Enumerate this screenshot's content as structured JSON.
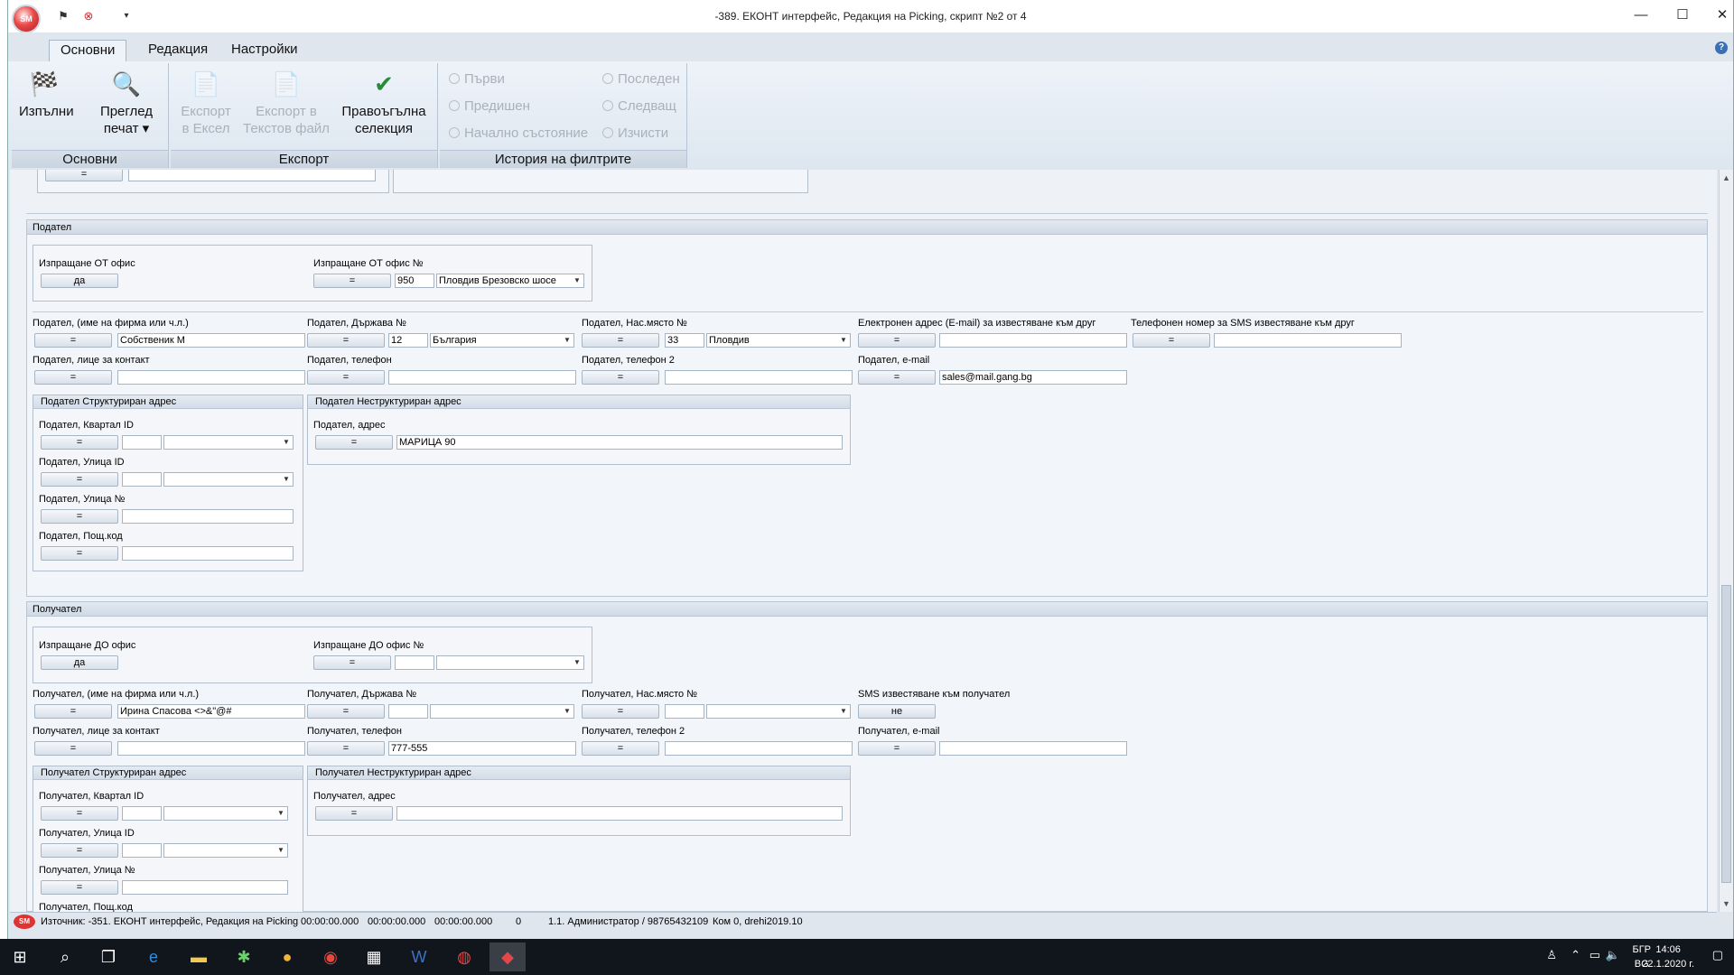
{
  "window": {
    "title": "-389. ЕКОНТ интерфейс, Редакция на Picking, скрипт №2 от 4",
    "app_badge": "SM",
    "minimize": "—",
    "maximize": "☐",
    "close": "✕"
  },
  "ribbon": {
    "tabs": [
      "Основни",
      "Редакция",
      "Настройки"
    ],
    "groups": {
      "main": {
        "caption": "Основни",
        "run_label": "Изпълни",
        "preview_label_1": "Преглед",
        "preview_label_2": "печат ▾"
      },
      "export": {
        "caption": "Експорт",
        "excel_1": "Експорт",
        "excel_2": "в Ексел",
        "text_1": "Експорт в",
        "text_2": "Текстов файл",
        "rect_1": "Правоъгълна",
        "rect_2": "селекция"
      },
      "history": {
        "caption": "История на филтрите",
        "first": "Първи",
        "last": "Последен",
        "prev": "Предишен",
        "next": "Следващ",
        "initial": "Начално състояние",
        "clear": "Изчисти"
      }
    }
  },
  "sender": {
    "section_title": "Подател",
    "office_flag_label": "Изпращане ОТ офис",
    "office_flag_value": "да",
    "office_no_label": "Изпращане ОТ офис №",
    "office_no": "950",
    "office_name": "Пловдив Брезовско шосе",
    "name_label": "Подател, (име на фирма или ч.л.)",
    "name_value": "Собственик М",
    "country_label": "Подател, Държава №",
    "country_no": "12",
    "country_name": "България",
    "city_label": "Подател, Нас.място №",
    "city_no": "33",
    "city_name": "Пловдив",
    "email_notify_label": "Електронен адрес (E-mail) за известяване към друг",
    "sms_notify_label": "Телефонен номер за SMS известяване към друг",
    "contact_label": "Подател, лице за контакт",
    "phone_label": "Подател, телефон",
    "phone2_label": "Подател, телефон 2",
    "email_label": "Подател, e-mail",
    "email_value": "sales@mail.gang.bg",
    "struct_title": "Подател Структуриран адрес",
    "quarter_label": "Подател, Квартал ID",
    "street_label": "Подател, Улица ID",
    "street_no_label": "Подател, Улица №",
    "postcode_label": "Подател, Пощ.код",
    "unstruct_title": "Подател Неструктуриран адрес",
    "address_label": "Подател, адрес",
    "address_value": "МАРИЦА 90"
  },
  "receiver": {
    "section_title": "Получател",
    "office_flag_label": "Изпращане ДО офис",
    "office_flag_value": "да",
    "office_no_label": "Изпращане ДО офис №",
    "name_label": "Получател, (име на фирма или ч.л.)",
    "name_value": "Ирина Спасова <>&\"@#",
    "country_label": "Получател, Държава №",
    "city_label": "Получател, Нас.място №",
    "sms_label": "SMS известяване към получател",
    "sms_value": "не",
    "contact_label": "Получател, лице за контакт",
    "phone_label": "Получател, телефон",
    "phone_value": "777-555",
    "phone2_label": "Получател, телефон 2",
    "email_label": "Получател, e-mail",
    "struct_title": "Получател Структуриран адрес",
    "quarter_label": "Получател, Квартал ID",
    "street_label": "Получател, Улица ID",
    "street_no_label": "Получател, Улица №",
    "postcode_label": "Получател, Пощ.код",
    "unstruct_title": "Получател Неструктуриран адрес",
    "address_label": "Получател, адрес"
  },
  "common": {
    "eq": "="
  },
  "statusbar": {
    "source": "Източник: -351. ЕКОНТ интерфейс, Редакция на Picking",
    "t1": "00:00:00.000",
    "t2": "00:00:00.000",
    "t3": "00:00:00.000",
    "count": "0",
    "user": "1.1. Администратор / 98765432109",
    "info": "Ком 0, drehi2019.10"
  },
  "taskbar": {
    "lang_top": "БГР",
    "lang_bottom": "BG",
    "time": "14:06",
    "date": "22.1.2020 г."
  }
}
